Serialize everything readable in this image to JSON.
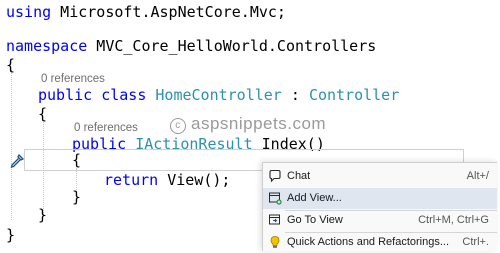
{
  "code": {
    "using_kw": "using",
    "using_ns": " Microsoft.AspNetCore.Mvc;",
    "namespace_kw": "namespace",
    "namespace_name": " MVC_Core_HelloWorld.Controllers",
    "open_brace": "{",
    "close_brace": "}",
    "class_refs": "0 references",
    "class_public": "public",
    "class_kw": "class",
    "class_name": "HomeController",
    "class_colon": " : ",
    "class_base": "Controller",
    "method_refs": "0 references",
    "method_public": "public",
    "method_return_type": "IActionResult",
    "method_name": " Index()",
    "return_kw": "return",
    "return_expr": " View();"
  },
  "watermark": {
    "symbol": "c",
    "text": "aspsnippets.com"
  },
  "context_menu": {
    "items": [
      {
        "label": "Chat",
        "shortcut": "Alt+/",
        "icon": "chat-icon"
      },
      {
        "label": "Add View...",
        "shortcut": "",
        "icon": "add-view-icon"
      },
      {
        "label": "Go To View",
        "shortcut": "Ctrl+M, Ctrl+G",
        "icon": "go-to-view-icon"
      },
      {
        "label": "Quick Actions and Refactorings...",
        "shortcut": "Ctrl+.",
        "icon": "lightbulb-icon"
      }
    ]
  },
  "colors": {
    "keyword": "#0000ff",
    "type": "#2b91af",
    "text": "#000000",
    "code_lens": "#6e6e6e"
  }
}
